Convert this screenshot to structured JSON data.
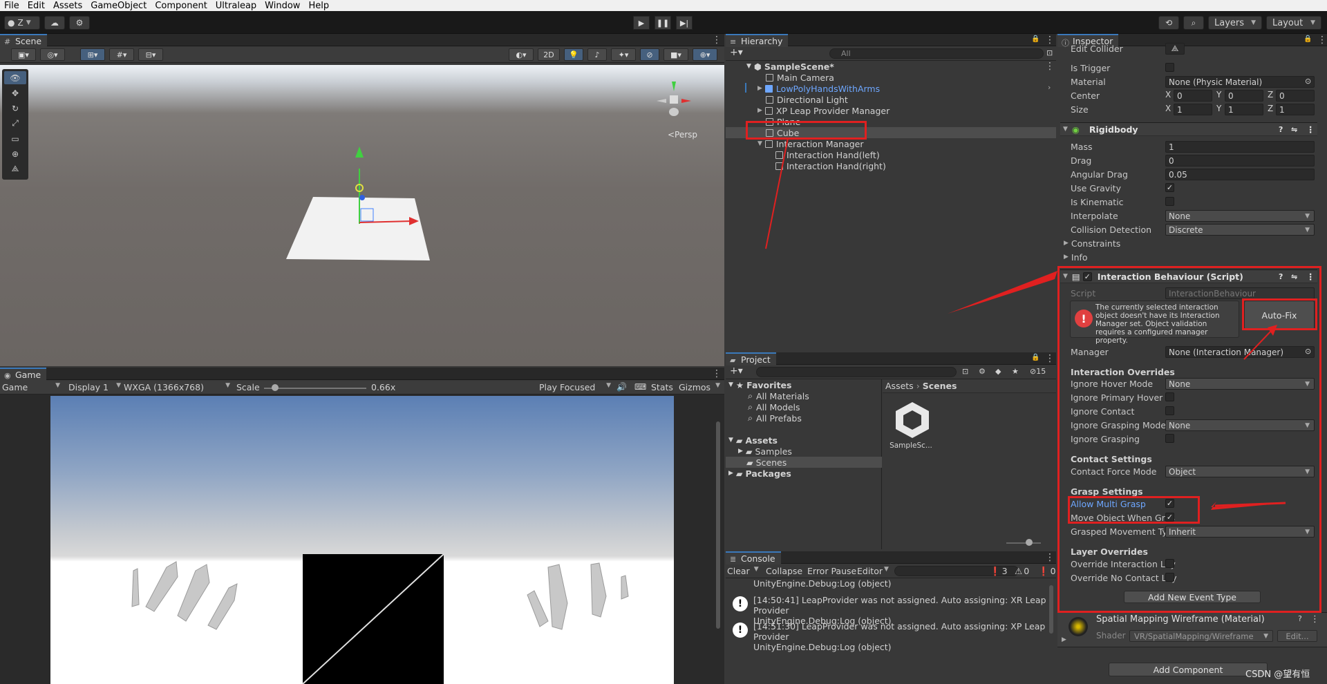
{
  "menu": [
    "File",
    "Edit",
    "Assets",
    "GameObject",
    "Component",
    "Ultraleap",
    "Window",
    "Help"
  ],
  "toolbar": {
    "account": "Z",
    "layers": "Layers",
    "layout": "Layout"
  },
  "scene": {
    "tab": "Scene",
    "persp": "<Persp",
    "btn2d": "2D"
  },
  "game": {
    "tab": "Game",
    "display_mode": "Game",
    "display": "Display 1",
    "resolution": "WXGA (1366x768)",
    "scale_label": "Scale",
    "scale_value": "0.66x",
    "play_mode": "Play Focused",
    "stats": "Stats",
    "gizmos": "Gizmos"
  },
  "hierarchy": {
    "tab": "Hierarchy",
    "search_placeholder": "All",
    "items": [
      {
        "label": "SampleScene*"
      },
      {
        "label": "Main Camera"
      },
      {
        "label": "LowPolyHandsWithArms"
      },
      {
        "label": "Directional Light"
      },
      {
        "label": "XP Leap Provider Manager"
      },
      {
        "label": "Plane"
      },
      {
        "label": "Cube"
      },
      {
        "label": "Interaction Manager"
      },
      {
        "label": "Interaction Hand(left)"
      },
      {
        "label": "Interaction Hand(right)"
      }
    ]
  },
  "project": {
    "tab": "Project",
    "count": "15",
    "favorites": "Favorites",
    "fav_items": [
      "All Materials",
      "All Models",
      "All Prefabs"
    ],
    "assets": "Assets",
    "asset_items": [
      "Samples",
      "Scenes"
    ],
    "packages": "Packages",
    "breadcrumb": [
      "Assets",
      "Scenes"
    ],
    "file": "SampleSc..."
  },
  "console": {
    "tab": "Console",
    "clear": "Clear",
    "collapse": "Collapse",
    "error_pause": "Error Pause",
    "editor": "Editor",
    "count_msg": "3",
    "count_warn": "0",
    "count_err": "0",
    "top_line": "UnityEngine.Debug:Log (object)",
    "messages": [
      {
        "line1": "[14:50:41] LeapProvider was not assigned. Auto assigning: XR Leap Provider",
        "line2": "UnityEngine.Debug:Log (object)"
      },
      {
        "line1": "[14:51:30] LeapProvider was not assigned. Auto assigning: XP Leap Provider",
        "line2": "UnityEngine.Debug:Log (object)"
      }
    ]
  },
  "inspector": {
    "tab": "Inspector",
    "edit_collider": "Edit Collider",
    "is_trigger": "Is Trigger",
    "material_label": "Material",
    "material_value": "None (Physic Material)",
    "center_label": "Center",
    "center": [
      "0",
      "0",
      "0"
    ],
    "size_label": "Size",
    "size": [
      "1",
      "1",
      "1"
    ],
    "rigidbody": {
      "title": "Rigidbody",
      "mass_label": "Mass",
      "mass": "1",
      "drag_label": "Drag",
      "drag": "0",
      "adrag_label": "Angular Drag",
      "adrag": "0.05",
      "gravity_label": "Use Gravity",
      "kinematic_label": "Is Kinematic",
      "interp_label": "Interpolate",
      "interp": "None",
      "coll_label": "Collision Detection",
      "coll": "Discrete",
      "constraints": "Constraints",
      "info": "Info"
    },
    "ib": {
      "title": "Interaction Behaviour (Script)",
      "script_label": "Script",
      "script_value": "InteractionBehaviour",
      "warning": "The currently selected interaction object doesn't have its Interaction Manager set. Object validation requires a configured manager property.",
      "autofix": "Auto-Fix",
      "manager_label": "Manager",
      "manager_value": "None (Interaction Manager)",
      "overrides_title": "Interaction Overrides",
      "hover_mode_label": "Ignore Hover Mode",
      "hover_mode": "None",
      "primary_hover_label": "Ignore Primary Hover",
      "contact_label": "Ignore Contact",
      "grasp_mode_label": "Ignore Grasping Mode",
      "grasp_mode": "None",
      "grasping_label": "Ignore Grasping",
      "contact_title": "Contact Settings",
      "force_label": "Contact Force Mode",
      "force": "Object",
      "grasp_title": "Grasp Settings",
      "multi_label": "Allow Multi Grasp",
      "move_label": "Move Object When Gras",
      "movement_label": "Grasped Movement Typ",
      "movement": "Inherit",
      "layer_title": "Layer Overrides",
      "ovr_layer_label": "Override Interaction Lay",
      "ovr_contact_label": "Override No Contact Lay",
      "add_event": "Add New Event Type"
    },
    "material": {
      "title": "Spatial Mapping Wireframe (Material)",
      "shader_label": "Shader",
      "shader": "VR/SpatialMapping/Wireframe",
      "edit": "Edit..."
    },
    "add_component": "Add Component"
  },
  "watermark": "CSDN @望有恒"
}
